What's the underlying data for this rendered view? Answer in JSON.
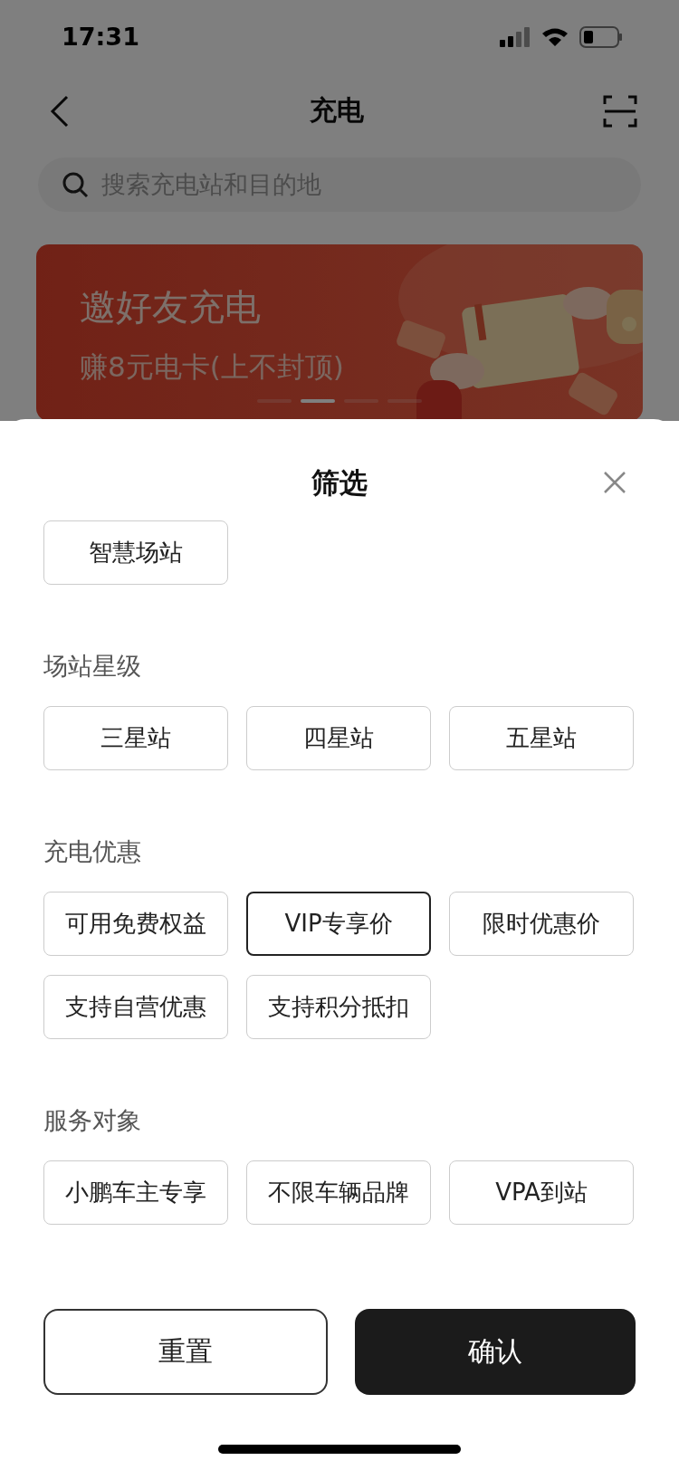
{
  "status_bar": {
    "time": "17:31"
  },
  "nav": {
    "title": "充电"
  },
  "search": {
    "placeholder": "搜索充电站和目的地"
  },
  "banner": {
    "title": "邀好友充电",
    "subtitle": "赚8元电卡(上不封顶)",
    "dots": [
      {
        "selected": false
      },
      {
        "selected": true
      },
      {
        "selected": false
      },
      {
        "selected": false
      }
    ]
  },
  "filter_sheet": {
    "title": "筛选",
    "sections": [
      {
        "options": [
          {
            "label": "智慧场站",
            "selected": false
          }
        ]
      },
      {
        "title": "场站星级",
        "options": [
          {
            "label": "三星站",
            "selected": false
          },
          {
            "label": "四星站",
            "selected": false
          },
          {
            "label": "五星站",
            "selected": false
          }
        ]
      },
      {
        "title": "充电优惠",
        "options": [
          {
            "label": "可用免费权益",
            "selected": false
          },
          {
            "label": "VIP专享价",
            "selected": true
          },
          {
            "label": "限时优惠价",
            "selected": false
          },
          {
            "label": "支持自营优惠",
            "selected": false
          },
          {
            "label": "支持积分抵扣",
            "selected": false
          }
        ]
      },
      {
        "title": "服务对象",
        "options": [
          {
            "label": "小鹏车主专享",
            "selected": false
          },
          {
            "label": "不限车辆品牌",
            "selected": false
          },
          {
            "label": "VPA到站",
            "selected": false
          }
        ]
      }
    ],
    "buttons": [
      {
        "kind": "secondary",
        "label": "重置"
      },
      {
        "kind": "primary",
        "label": "确认"
      }
    ]
  }
}
